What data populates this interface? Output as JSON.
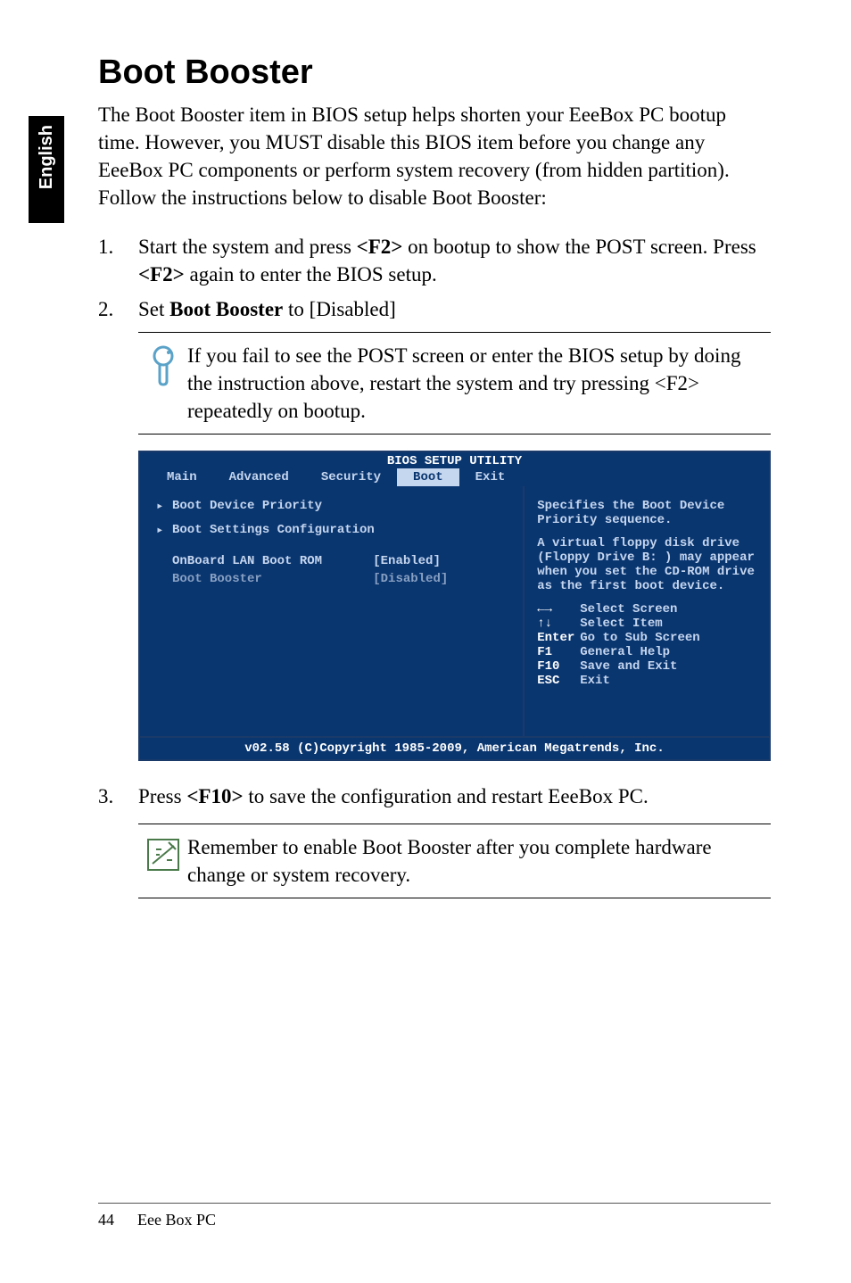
{
  "sidebar": {
    "label": "English"
  },
  "title": "Boot Booster",
  "intro": "The Boot Booster item in BIOS setup helps shorten your EeeBox PC bootup time. However, you MUST disable this BIOS item before you change any EeeBox PC components or perform system recovery (from hidden partition). Follow the instructions below to disable Boot Booster:",
  "steps": {
    "s1_num": "1.",
    "s1_pre": "Start the system and press ",
    "s1_key1": "<F2>",
    "s1_mid": " on bootup to show the POST screen. Press ",
    "s1_key2": "<F2>",
    "s1_post": " again to enter the BIOS setup.",
    "s2_num": "2.",
    "s2_pre": "Set ",
    "s2_bold": "Boot Booster",
    "s2_post": " to [Disabled]",
    "s3_num": "3.",
    "s3_pre": "Press ",
    "s3_key": "<F10>",
    "s3_post": " to save the configuration and restart EeeBox PC."
  },
  "tip1": "If you fail to see the POST screen or enter the BIOS setup by doing the instruction above, restart the system and try pressing <F2> repeatedly on bootup.",
  "tip2": "Remember to enable Boot Booster after you complete hardware change or system recovery.",
  "bios": {
    "title": "BIOS SETUP UTILITY",
    "tabs": [
      "Main",
      "Advanced",
      "Security",
      "Boot",
      "Exit"
    ],
    "active_tab_index": 3,
    "left": {
      "row1": "Boot Device Priority",
      "row2": "Boot Settings Configuration",
      "row3_label": "OnBoard LAN Boot ROM",
      "row3_value": "[Enabled]",
      "row4_label": "Boot Booster",
      "row4_value": "[Disabled]"
    },
    "right": {
      "help1": "Specifies the Boot Device Priority sequence.",
      "help2": "A virtual floppy disk drive (Floppy Drive B: ) may appear when you set the CD-ROM drive as the first boot device.",
      "nav": [
        {
          "key": "←→",
          "label": "Select Screen"
        },
        {
          "key": "↑↓",
          "label": "Select Item"
        },
        {
          "key": "Enter",
          "label": "Go to Sub Screen"
        },
        {
          "key": "F1",
          "label": "General Help"
        },
        {
          "key": "F10",
          "label": "Save and Exit"
        },
        {
          "key": "ESC",
          "label": "Exit"
        }
      ]
    },
    "footer": "v02.58 (C)Copyright 1985-2009, American Megatrends, Inc."
  },
  "footer": {
    "page": "44",
    "product": "Eee Box PC"
  }
}
